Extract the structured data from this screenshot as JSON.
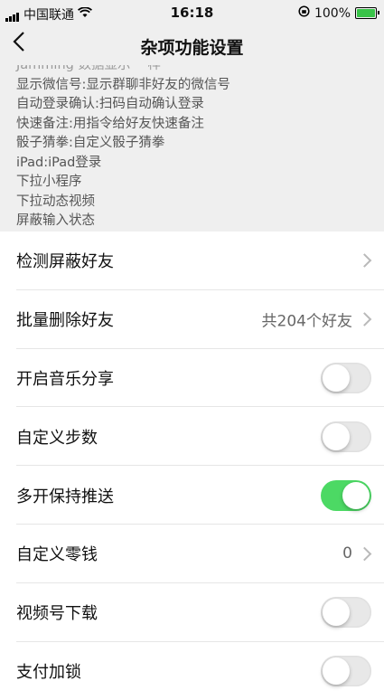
{
  "status_bar": {
    "carrier": "中国联通",
    "time": "16:18",
    "battery": "100%"
  },
  "nav": {
    "back_label": "<",
    "title": "杂项功能设置"
  },
  "description_lines": [
    "Jamming 数据显示 一样",
    "显示微信号:显示群聊非好友的微信号",
    "自动登录确认:扫码自动确认登录",
    "快速备注:用指令给好友快速备注",
    "骰子猜拳:自定义骰子猜拳",
    "iPad:iPad登录",
    "下拉小程序",
    "下拉动态视频",
    "屏蔽输入状态"
  ],
  "rows": [
    {
      "label": "检测屏蔽好友",
      "kind": "link",
      "value": ""
    },
    {
      "label": "批量删除好友",
      "kind": "link",
      "value": "共204个好友"
    },
    {
      "label": "开启音乐分享",
      "kind": "toggle",
      "on": false
    },
    {
      "label": "自定义步数",
      "kind": "toggle",
      "on": false
    },
    {
      "label": "多开保持推送",
      "kind": "toggle",
      "on": true
    },
    {
      "label": "自定义零钱",
      "kind": "link",
      "value": "0"
    },
    {
      "label": "视频号下载",
      "kind": "toggle",
      "on": false
    },
    {
      "label": "支付加锁",
      "kind": "toggle",
      "on": false
    }
  ],
  "colors": {
    "toggle_on": "#4cd964",
    "background_gray": "#efefef"
  }
}
